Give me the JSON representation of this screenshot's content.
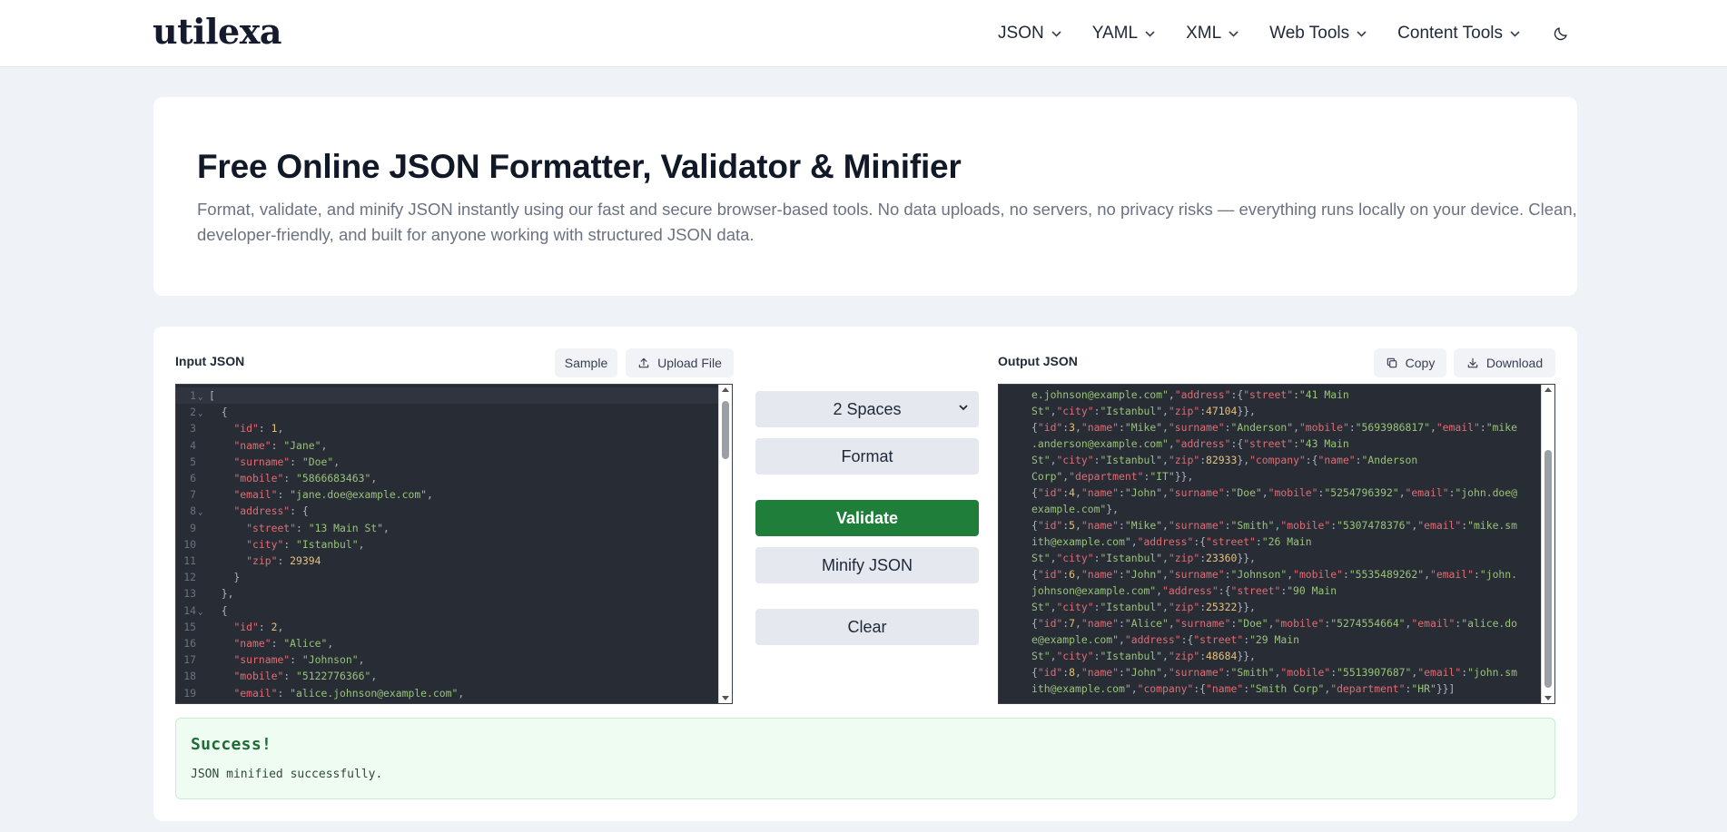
{
  "brand": {
    "logo": "utilexa"
  },
  "nav": {
    "items": [
      {
        "label": "JSON"
      },
      {
        "label": "YAML"
      },
      {
        "label": "XML"
      },
      {
        "label": "Web Tools"
      },
      {
        "label": "Content Tools"
      }
    ],
    "theme_icon": "moon-icon"
  },
  "hero": {
    "title": "Free Online JSON Formatter, Validator & Minifier",
    "description": "Format, validate, and minify JSON instantly using our fast and secure browser-based tools. No data uploads, no servers, no privacy risks — everything runs locally on your device. Clean, developer-friendly, and built for anyone working with structured JSON data."
  },
  "input": {
    "label": "Input JSON",
    "sample_label": "Sample",
    "upload_label": "Upload File",
    "lines": [
      {
        "n": "1",
        "fold": true,
        "parts": [
          [
            "p",
            "["
          ]
        ]
      },
      {
        "n": "2",
        "fold": true,
        "parts": [
          [
            "p",
            "  {"
          ]
        ]
      },
      {
        "n": "3",
        "parts": [
          [
            "p",
            "    "
          ],
          [
            "k",
            "\"id\""
          ],
          [
            "p",
            ": "
          ],
          [
            "n",
            "1"
          ],
          [
            "p",
            ","
          ]
        ]
      },
      {
        "n": "4",
        "parts": [
          [
            "p",
            "    "
          ],
          [
            "k",
            "\"name\""
          ],
          [
            "p",
            ": "
          ],
          [
            "s",
            "\"Jane\""
          ],
          [
            "p",
            ","
          ]
        ]
      },
      {
        "n": "5",
        "parts": [
          [
            "p",
            "    "
          ],
          [
            "k",
            "\"surname\""
          ],
          [
            "p",
            ": "
          ],
          [
            "s",
            "\"Doe\""
          ],
          [
            "p",
            ","
          ]
        ]
      },
      {
        "n": "6",
        "parts": [
          [
            "p",
            "    "
          ],
          [
            "k",
            "\"mobile\""
          ],
          [
            "p",
            ": "
          ],
          [
            "s",
            "\"5866683463\""
          ],
          [
            "p",
            ","
          ]
        ]
      },
      {
        "n": "7",
        "parts": [
          [
            "p",
            "    "
          ],
          [
            "k",
            "\"email\""
          ],
          [
            "p",
            ": "
          ],
          [
            "s",
            "\"jane.doe@example.com\""
          ],
          [
            "p",
            ","
          ]
        ]
      },
      {
        "n": "8",
        "fold": true,
        "parts": [
          [
            "p",
            "    "
          ],
          [
            "k",
            "\"address\""
          ],
          [
            "p",
            ": {"
          ]
        ]
      },
      {
        "n": "9",
        "parts": [
          [
            "p",
            "      "
          ],
          [
            "k",
            "\"street\""
          ],
          [
            "p",
            ": "
          ],
          [
            "s",
            "\"13 Main St\""
          ],
          [
            "p",
            ","
          ]
        ]
      },
      {
        "n": "10",
        "parts": [
          [
            "p",
            "      "
          ],
          [
            "k",
            "\"city\""
          ],
          [
            "p",
            ": "
          ],
          [
            "s",
            "\"Istanbul\""
          ],
          [
            "p",
            ","
          ]
        ]
      },
      {
        "n": "11",
        "parts": [
          [
            "p",
            "      "
          ],
          [
            "k",
            "\"zip\""
          ],
          [
            "p",
            ": "
          ],
          [
            "n",
            "29394"
          ]
        ]
      },
      {
        "n": "12",
        "parts": [
          [
            "p",
            "    }"
          ]
        ]
      },
      {
        "n": "13",
        "parts": [
          [
            "p",
            "  },"
          ]
        ]
      },
      {
        "n": "14",
        "fold": true,
        "parts": [
          [
            "p",
            "  {"
          ]
        ]
      },
      {
        "n": "15",
        "parts": [
          [
            "p",
            "    "
          ],
          [
            "k",
            "\"id\""
          ],
          [
            "p",
            ": "
          ],
          [
            "n",
            "2"
          ],
          [
            "p",
            ","
          ]
        ]
      },
      {
        "n": "16",
        "parts": [
          [
            "p",
            "    "
          ],
          [
            "k",
            "\"name\""
          ],
          [
            "p",
            ": "
          ],
          [
            "s",
            "\"Alice\""
          ],
          [
            "p",
            ","
          ]
        ]
      },
      {
        "n": "17",
        "parts": [
          [
            "p",
            "    "
          ],
          [
            "k",
            "\"surname\""
          ],
          [
            "p",
            ": "
          ],
          [
            "s",
            "\"Johnson\""
          ],
          [
            "p",
            ","
          ]
        ]
      },
      {
        "n": "18",
        "parts": [
          [
            "p",
            "    "
          ],
          [
            "k",
            "\"mobile\""
          ],
          [
            "p",
            ": "
          ],
          [
            "s",
            "\"5122776366\""
          ],
          [
            "p",
            ","
          ]
        ]
      },
      {
        "n": "19",
        "parts": [
          [
            "p",
            "    "
          ],
          [
            "k",
            "\"email\""
          ],
          [
            "p",
            ": "
          ],
          [
            "s",
            "\"alice.johnson@example.com\""
          ],
          [
            "p",
            ","
          ]
        ]
      }
    ]
  },
  "controls": {
    "indent_value": "2 Spaces",
    "format_label": "Format",
    "validate_label": "Validate",
    "minify_label": "Minify JSON",
    "clear_label": "Clear"
  },
  "output": {
    "label": "Output JSON",
    "copy_label": "Copy",
    "download_label": "Download",
    "lines": [
      [
        [
          "s",
          "e.johnson@example.com\""
        ],
        [
          "p",
          ","
        ],
        [
          "k",
          "\"address\""
        ],
        [
          "p",
          ":{"
        ],
        [
          "k",
          "\"street\""
        ],
        [
          "p",
          ":"
        ],
        [
          "s",
          "\"41 Main"
        ]
      ],
      [
        [
          "s",
          "St\""
        ],
        [
          "p",
          ","
        ],
        [
          "k",
          "\"city\""
        ],
        [
          "p",
          ":"
        ],
        [
          "s",
          "\"Istanbul\""
        ],
        [
          "p",
          ","
        ],
        [
          "k",
          "\"zip\""
        ],
        [
          "p",
          ":"
        ],
        [
          "n",
          "47104"
        ],
        [
          "p",
          "}},"
        ]
      ],
      [
        [
          "p",
          "{"
        ],
        [
          "k",
          "\"id\""
        ],
        [
          "p",
          ":"
        ],
        [
          "n",
          "3"
        ],
        [
          "p",
          ","
        ],
        [
          "k",
          "\"name\""
        ],
        [
          "p",
          ":"
        ],
        [
          "s",
          "\"Mike\""
        ],
        [
          "p",
          ","
        ],
        [
          "k",
          "\"surname\""
        ],
        [
          "p",
          ":"
        ],
        [
          "s",
          "\"Anderson\""
        ],
        [
          "p",
          ","
        ],
        [
          "k",
          "\"mobile\""
        ],
        [
          "p",
          ":"
        ],
        [
          "s",
          "\"5693986817\""
        ],
        [
          "p",
          ","
        ],
        [
          "k",
          "\"email\""
        ],
        [
          "p",
          ":"
        ],
        [
          "s",
          "\"mike"
        ]
      ],
      [
        [
          "s",
          ".anderson@example.com\""
        ],
        [
          "p",
          ","
        ],
        [
          "k",
          "\"address\""
        ],
        [
          "p",
          ":{"
        ],
        [
          "k",
          "\"street\""
        ],
        [
          "p",
          ":"
        ],
        [
          "s",
          "\"43 Main"
        ]
      ],
      [
        [
          "s",
          "St\""
        ],
        [
          "p",
          ","
        ],
        [
          "k",
          "\"city\""
        ],
        [
          "p",
          ":"
        ],
        [
          "s",
          "\"Istanbul\""
        ],
        [
          "p",
          ","
        ],
        [
          "k",
          "\"zip\""
        ],
        [
          "p",
          ":"
        ],
        [
          "n",
          "82933"
        ],
        [
          "p",
          "},"
        ],
        [
          "k",
          "\"company\""
        ],
        [
          "p",
          ":{"
        ],
        [
          "k",
          "\"name\""
        ],
        [
          "p",
          ":"
        ],
        [
          "s",
          "\"Anderson"
        ]
      ],
      [
        [
          "s",
          "Corp\""
        ],
        [
          "p",
          ","
        ],
        [
          "k",
          "\"department\""
        ],
        [
          "p",
          ":"
        ],
        [
          "s",
          "\"IT\""
        ],
        [
          "p",
          "}},"
        ]
      ],
      [
        [
          "p",
          "{"
        ],
        [
          "k",
          "\"id\""
        ],
        [
          "p",
          ":"
        ],
        [
          "n",
          "4"
        ],
        [
          "p",
          ","
        ],
        [
          "k",
          "\"name\""
        ],
        [
          "p",
          ":"
        ],
        [
          "s",
          "\"John\""
        ],
        [
          "p",
          ","
        ],
        [
          "k",
          "\"surname\""
        ],
        [
          "p",
          ":"
        ],
        [
          "s",
          "\"Doe\""
        ],
        [
          "p",
          ","
        ],
        [
          "k",
          "\"mobile\""
        ],
        [
          "p",
          ":"
        ],
        [
          "s",
          "\"5254796392\""
        ],
        [
          "p",
          ","
        ],
        [
          "k",
          "\"email\""
        ],
        [
          "p",
          ":"
        ],
        [
          "s",
          "\"john.doe@"
        ]
      ],
      [
        [
          "s",
          "example.com\""
        ],
        [
          "p",
          "},"
        ]
      ],
      [
        [
          "p",
          "{"
        ],
        [
          "k",
          "\"id\""
        ],
        [
          "p",
          ":"
        ],
        [
          "n",
          "5"
        ],
        [
          "p",
          ","
        ],
        [
          "k",
          "\"name\""
        ],
        [
          "p",
          ":"
        ],
        [
          "s",
          "\"Mike\""
        ],
        [
          "p",
          ","
        ],
        [
          "k",
          "\"surname\""
        ],
        [
          "p",
          ":"
        ],
        [
          "s",
          "\"Smith\""
        ],
        [
          "p",
          ","
        ],
        [
          "k",
          "\"mobile\""
        ],
        [
          "p",
          ":"
        ],
        [
          "s",
          "\"5307478376\""
        ],
        [
          "p",
          ","
        ],
        [
          "k",
          "\"email\""
        ],
        [
          "p",
          ":"
        ],
        [
          "s",
          "\"mike.sm"
        ]
      ],
      [
        [
          "s",
          "ith@example.com\""
        ],
        [
          "p",
          ","
        ],
        [
          "k",
          "\"address\""
        ],
        [
          "p",
          ":{"
        ],
        [
          "k",
          "\"street\""
        ],
        [
          "p",
          ":"
        ],
        [
          "s",
          "\"26 Main"
        ]
      ],
      [
        [
          "s",
          "St\""
        ],
        [
          "p",
          ","
        ],
        [
          "k",
          "\"city\""
        ],
        [
          "p",
          ":"
        ],
        [
          "s",
          "\"Istanbul\""
        ],
        [
          "p",
          ","
        ],
        [
          "k",
          "\"zip\""
        ],
        [
          "p",
          ":"
        ],
        [
          "n",
          "23360"
        ],
        [
          "p",
          "}},"
        ]
      ],
      [
        [
          "p",
          "{"
        ],
        [
          "k",
          "\"id\""
        ],
        [
          "p",
          ":"
        ],
        [
          "n",
          "6"
        ],
        [
          "p",
          ","
        ],
        [
          "k",
          "\"name\""
        ],
        [
          "p",
          ":"
        ],
        [
          "s",
          "\"John\""
        ],
        [
          "p",
          ","
        ],
        [
          "k",
          "\"surname\""
        ],
        [
          "p",
          ":"
        ],
        [
          "s",
          "\"Johnson\""
        ],
        [
          "p",
          ","
        ],
        [
          "k",
          "\"mobile\""
        ],
        [
          "p",
          ":"
        ],
        [
          "s",
          "\"5535489262\""
        ],
        [
          "p",
          ","
        ],
        [
          "k",
          "\"email\""
        ],
        [
          "p",
          ":"
        ],
        [
          "s",
          "\"john."
        ]
      ],
      [
        [
          "s",
          "johnson@example.com\""
        ],
        [
          "p",
          ","
        ],
        [
          "k",
          "\"address\""
        ],
        [
          "p",
          ":{"
        ],
        [
          "k",
          "\"street\""
        ],
        [
          "p",
          ":"
        ],
        [
          "s",
          "\"90 Main"
        ]
      ],
      [
        [
          "s",
          "St\""
        ],
        [
          "p",
          ","
        ],
        [
          "k",
          "\"city\""
        ],
        [
          "p",
          ":"
        ],
        [
          "s",
          "\"Istanbul\""
        ],
        [
          "p",
          ","
        ],
        [
          "k",
          "\"zip\""
        ],
        [
          "p",
          ":"
        ],
        [
          "n",
          "25322"
        ],
        [
          "p",
          "}},"
        ]
      ],
      [
        [
          "p",
          "{"
        ],
        [
          "k",
          "\"id\""
        ],
        [
          "p",
          ":"
        ],
        [
          "n",
          "7"
        ],
        [
          "p",
          ","
        ],
        [
          "k",
          "\"name\""
        ],
        [
          "p",
          ":"
        ],
        [
          "s",
          "\"Alice\""
        ],
        [
          "p",
          ","
        ],
        [
          "k",
          "\"surname\""
        ],
        [
          "p",
          ":"
        ],
        [
          "s",
          "\"Doe\""
        ],
        [
          "p",
          ","
        ],
        [
          "k",
          "\"mobile\""
        ],
        [
          "p",
          ":"
        ],
        [
          "s",
          "\"5274554664\""
        ],
        [
          "p",
          ","
        ],
        [
          "k",
          "\"email\""
        ],
        [
          "p",
          ":"
        ],
        [
          "s",
          "\"alice.do"
        ]
      ],
      [
        [
          "s",
          "e@example.com\""
        ],
        [
          "p",
          ","
        ],
        [
          "k",
          "\"address\""
        ],
        [
          "p",
          ":{"
        ],
        [
          "k",
          "\"street\""
        ],
        [
          "p",
          ":"
        ],
        [
          "s",
          "\"29 Main"
        ]
      ],
      [
        [
          "s",
          "St\""
        ],
        [
          "p",
          ","
        ],
        [
          "k",
          "\"city\""
        ],
        [
          "p",
          ":"
        ],
        [
          "s",
          "\"Istanbul\""
        ],
        [
          "p",
          ","
        ],
        [
          "k",
          "\"zip\""
        ],
        [
          "p",
          ":"
        ],
        [
          "n",
          "48684"
        ],
        [
          "p",
          "}},"
        ]
      ],
      [
        [
          "p",
          "{"
        ],
        [
          "k",
          "\"id\""
        ],
        [
          "p",
          ":"
        ],
        [
          "n",
          "8"
        ],
        [
          "p",
          ","
        ],
        [
          "k",
          "\"name\""
        ],
        [
          "p",
          ":"
        ],
        [
          "s",
          "\"John\""
        ],
        [
          "p",
          ","
        ],
        [
          "k",
          "\"surname\""
        ],
        [
          "p",
          ":"
        ],
        [
          "s",
          "\"Smith\""
        ],
        [
          "p",
          ","
        ],
        [
          "k",
          "\"mobile\""
        ],
        [
          "p",
          ":"
        ],
        [
          "s",
          "\"5513907687\""
        ],
        [
          "p",
          ","
        ],
        [
          "k",
          "\"email\""
        ],
        [
          "p",
          ":"
        ],
        [
          "s",
          "\"john.sm"
        ]
      ],
      [
        [
          "s",
          "ith@example.com\""
        ],
        [
          "p",
          ","
        ],
        [
          "k",
          "\"company\""
        ],
        [
          "p",
          ":{"
        ],
        [
          "k",
          "\"name\""
        ],
        [
          "p",
          ":"
        ],
        [
          "s",
          "\"Smith Corp\""
        ],
        [
          "p",
          ","
        ],
        [
          "k",
          "\"department\""
        ],
        [
          "p",
          ":"
        ],
        [
          "s",
          "\"HR\""
        ],
        [
          "p",
          "}}]"
        ]
      ]
    ]
  },
  "status": {
    "title": "Success!",
    "message": "JSON minified successfully."
  },
  "colors": {
    "validate_green": "#1e7e3a",
    "editor_bg": "#282c34",
    "json_key": "#e06c75",
    "json_string": "#98c379",
    "json_number": "#e5c07b",
    "success_bg": "#effcf2"
  }
}
